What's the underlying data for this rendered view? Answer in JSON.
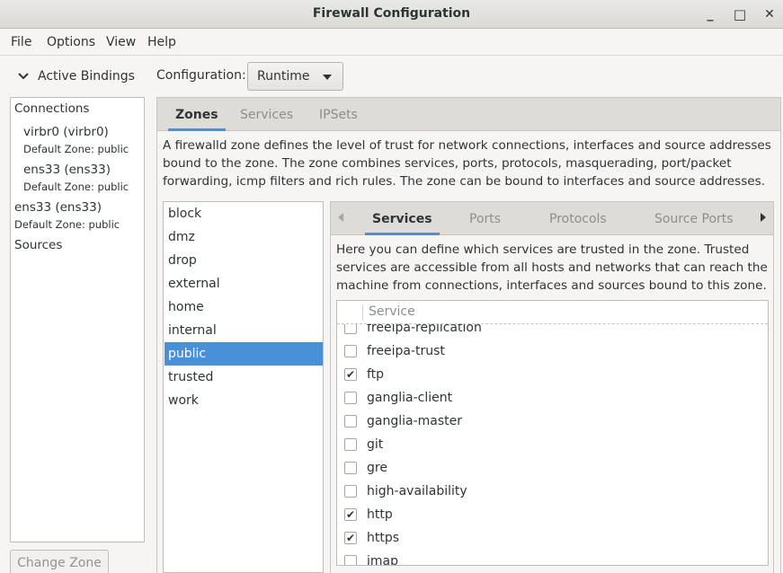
{
  "window": {
    "title": "Firewall Configuration",
    "minimize_glyph": "_",
    "maximize_glyph": "□",
    "close_glyph": "✕"
  },
  "menubar": {
    "items": [
      "File",
      "Options",
      "View",
      "Help"
    ]
  },
  "bindings": {
    "header": "Active Bindings",
    "connections_label": "Connections",
    "items": [
      {
        "name": "virbr0 (virbr0)",
        "zone": "Default Zone: public"
      },
      {
        "name": "ens33 (ens33)",
        "zone": "Default Zone: public"
      },
      {
        "name": "ens33 (ens33)",
        "zone": "Default Zone: public"
      }
    ],
    "sources_label": "Sources",
    "change_zone_label": "Change Zone"
  },
  "configuration": {
    "label": "Configuration:",
    "value": "Runtime"
  },
  "main_tabs": [
    {
      "label": "Zones",
      "active": true
    },
    {
      "label": "Services",
      "active": false
    },
    {
      "label": "IPSets",
      "active": false
    }
  ],
  "zone_description": "A firewalld zone defines the level of trust for network connections, interfaces and source addresses bound to the zone. The zone combines services, ports, protocols, masquerading, port/packet forwarding, icmp filters and rich rules. The zone can be bound to interfaces and source addresses.",
  "zones": [
    {
      "name": "block",
      "selected": false
    },
    {
      "name": "dmz",
      "selected": false
    },
    {
      "name": "drop",
      "selected": false
    },
    {
      "name": "external",
      "selected": false
    },
    {
      "name": "home",
      "selected": false
    },
    {
      "name": "internal",
      "selected": false
    },
    {
      "name": "public",
      "selected": true
    },
    {
      "name": "trusted",
      "selected": false
    },
    {
      "name": "work",
      "selected": false
    }
  ],
  "sub_tabs": [
    {
      "label": "Services",
      "active": true
    },
    {
      "label": "Ports",
      "active": false
    },
    {
      "label": "Protocols",
      "active": false
    },
    {
      "label": "Source Ports",
      "active": false
    }
  ],
  "services_description": "Here you can define which services are trusted in the zone. Trusted services are accessible from all hosts and networks that can reach the machine from connections, interfaces and sources bound to this zone.",
  "service_list": {
    "column_header": "Service",
    "check_glyph": "✔",
    "rows": [
      {
        "name": "freeipa-replication",
        "checked": false
      },
      {
        "name": "freeipa-trust",
        "checked": false
      },
      {
        "name": "ftp",
        "checked": true
      },
      {
        "name": "ganglia-client",
        "checked": false
      },
      {
        "name": "ganglia-master",
        "checked": false
      },
      {
        "name": "git",
        "checked": false
      },
      {
        "name": "gre",
        "checked": false
      },
      {
        "name": "high-availability",
        "checked": false
      },
      {
        "name": "http",
        "checked": true
      },
      {
        "name": "https",
        "checked": true
      },
      {
        "name": "imap",
        "checked": false
      }
    ]
  },
  "colors": {
    "accent": "#4a90d9",
    "inactive_tab_text": "#8b8e8f",
    "disabled_text": "#929595"
  }
}
